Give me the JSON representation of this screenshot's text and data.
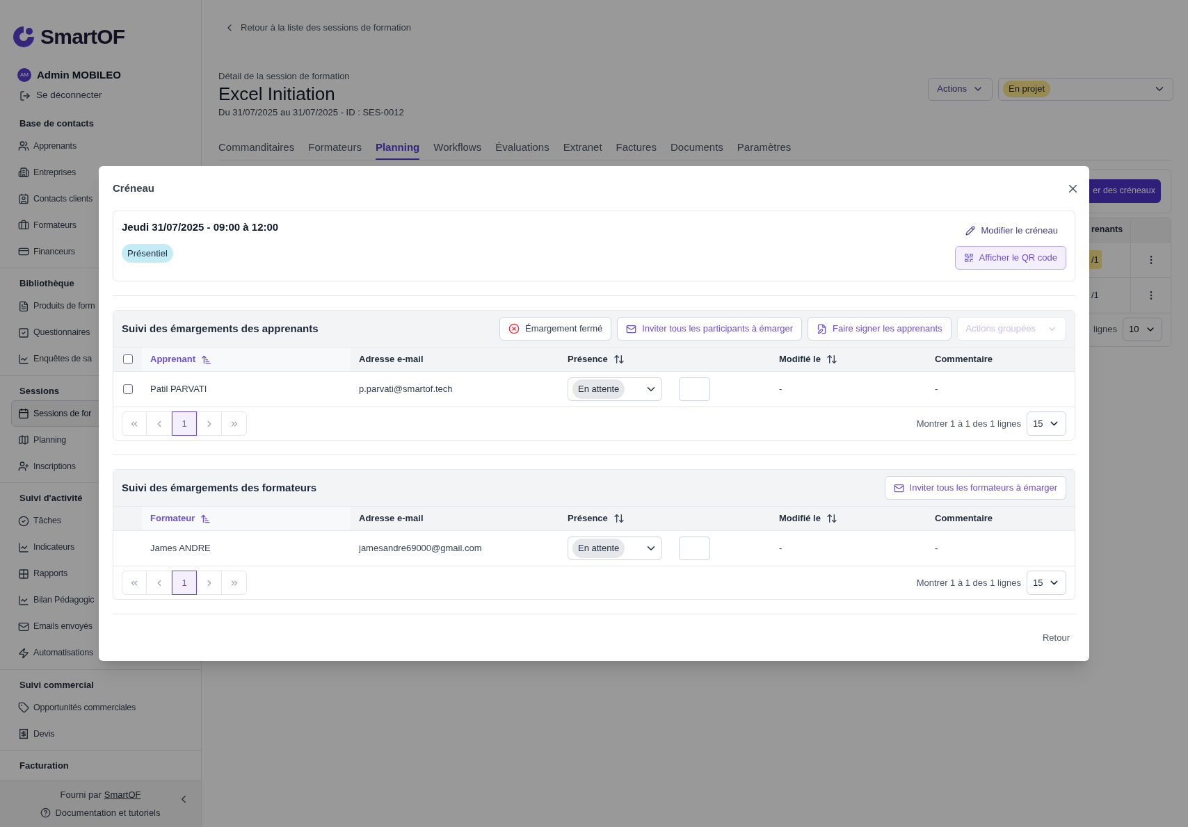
{
  "sidebar": {
    "brand": "SmartOF",
    "user": {
      "initials": "AM",
      "name": "Admin MOBILEO"
    },
    "logout": "Se déconnecter",
    "sections": [
      {
        "title": "Base de contacts",
        "items": [
          {
            "label": "Apprenants",
            "selected": false
          },
          {
            "label": "Entreprises",
            "selected": false
          },
          {
            "label": "Contacts clients",
            "selected": false
          },
          {
            "label": "Formateurs",
            "selected": false
          },
          {
            "label": "Financeurs",
            "selected": false
          }
        ]
      },
      {
        "title": "Bibliothèque",
        "items": [
          {
            "label": "Produits de form",
            "selected": false
          },
          {
            "label": "Questionnaires",
            "selected": false
          },
          {
            "label": "Enquêtes de sa",
            "selected": false
          }
        ]
      },
      {
        "title": "Sessions",
        "items": [
          {
            "label": "Sessions de for",
            "selected": true
          },
          {
            "label": "Planning",
            "selected": false
          },
          {
            "label": "Inscriptions",
            "selected": false
          }
        ]
      },
      {
        "title": "Suivi d'activité",
        "items": [
          {
            "label": "Tâches",
            "selected": false
          },
          {
            "label": "Indicateurs",
            "selected": false
          },
          {
            "label": "Rapports",
            "selected": false
          },
          {
            "label": "Bilan Pédagogic",
            "selected": false
          },
          {
            "label": "Emails envoyés",
            "selected": false
          },
          {
            "label": "Automatisations",
            "selected": false
          }
        ]
      },
      {
        "title": "Suivi commercial",
        "items": [
          {
            "label": "Opportunités commerciales",
            "selected": false
          },
          {
            "label": "Devis",
            "selected": false
          }
        ]
      },
      {
        "title": "Facturation"
      }
    ],
    "footer": {
      "provided_by": "Fourni par",
      "provider_link": "SmartOF",
      "docs": "Documentation et tutoriels"
    }
  },
  "page": {
    "back_link": "Retour à la liste des sessions de formation",
    "subtitle": "Détail de la session de formation",
    "title": "Excel Initiation",
    "dates": "Du 31/07/2025 au 31/07/2025 - ID : SES-0012",
    "actions_button": "Actions",
    "status": "En projet",
    "tabs": [
      {
        "label": "Commanditaires",
        "selected": false
      },
      {
        "label": "Formateurs",
        "selected": false
      },
      {
        "label": "Planning",
        "selected": true
      },
      {
        "label": "Workflows",
        "selected": false
      },
      {
        "label": "Évaluations",
        "selected": false
      },
      {
        "label": "Extranet",
        "selected": false
      },
      {
        "label": "Factures",
        "selected": false
      },
      {
        "label": "Documents",
        "selected": false
      },
      {
        "label": "Paramètres",
        "selected": false
      }
    ],
    "behind": {
      "create_button": "er des créneaux",
      "column": "renants",
      "rows": [
        {
          "count": "/1"
        },
        {
          "count": "/1"
        }
      ],
      "rows_info": "lignes",
      "page_size": "10"
    }
  },
  "modal": {
    "title": "Créneau",
    "slot": {
      "datetime": "Jeudi 31/07/2025 - 09:00 à 12:00",
      "mode": "Présentiel",
      "edit_link": "Modifier le créneau",
      "qr_button": "Afficher le QR code"
    },
    "sections": [
      {
        "title": "Suivi des émargements des apprenants",
        "actions": [
          {
            "label": "Émargement fermé",
            "kind": "status",
            "disabled": false
          },
          {
            "label": "Inviter tous les participants à émarger",
            "kind": "mail",
            "disabled": false
          },
          {
            "label": "Faire signer les apprenants",
            "kind": "sign",
            "disabled": false
          },
          {
            "label": "Actions groupées",
            "kind": "dropdown",
            "disabled": true
          }
        ],
        "select_all": {
          "checked": false
        },
        "columns": [
          {
            "label": "Apprenant",
            "sortable": true,
            "sorted": true
          },
          {
            "label": "Adresse e-mail",
            "sortable": false,
            "sorted": false
          },
          {
            "label": "Présence",
            "sortable": true,
            "sorted": false
          },
          {
            "label": "Modifié le",
            "sortable": true,
            "sorted": false
          },
          {
            "label": "Commentaire",
            "sortable": false,
            "sorted": false
          }
        ],
        "rows": [
          {
            "checked": false,
            "name": "Patil PARVATI",
            "email": "p.parvati@smartof.tech",
            "presence": "En attente",
            "modified": "-",
            "comment": "-"
          }
        ],
        "pagination": {
          "pages": [
            {
              "label": "1",
              "selected": true
            }
          ],
          "info": "Montrer 1 à 1 des 1 lignes",
          "page_size": "15"
        }
      },
      {
        "title": "Suivi des émargements des formateurs",
        "actions": [
          {
            "label": "Inviter tous les formateurs à émarger",
            "kind": "mail",
            "disabled": false
          }
        ],
        "columns": [
          {
            "label": "Formateur",
            "sortable": true,
            "sorted": true
          },
          {
            "label": "Adresse e-mail",
            "sortable": false,
            "sorted": false
          },
          {
            "label": "Présence",
            "sortable": true,
            "sorted": false
          },
          {
            "label": "Modifié le",
            "sortable": true,
            "sorted": false
          },
          {
            "label": "Commentaire",
            "sortable": false,
            "sorted": false
          }
        ],
        "rows": [
          {
            "name": "James ANDRE",
            "email": "jamesandre69000@gmail.com",
            "presence": "En attente",
            "modified": "-",
            "comment": "-"
          }
        ],
        "pagination": {
          "pages": [
            {
              "label": "1",
              "selected": true
            }
          ],
          "info": "Montrer 1 à 1 des 1 lignes",
          "page_size": "15"
        }
      }
    ],
    "close_button": "Retour"
  }
}
